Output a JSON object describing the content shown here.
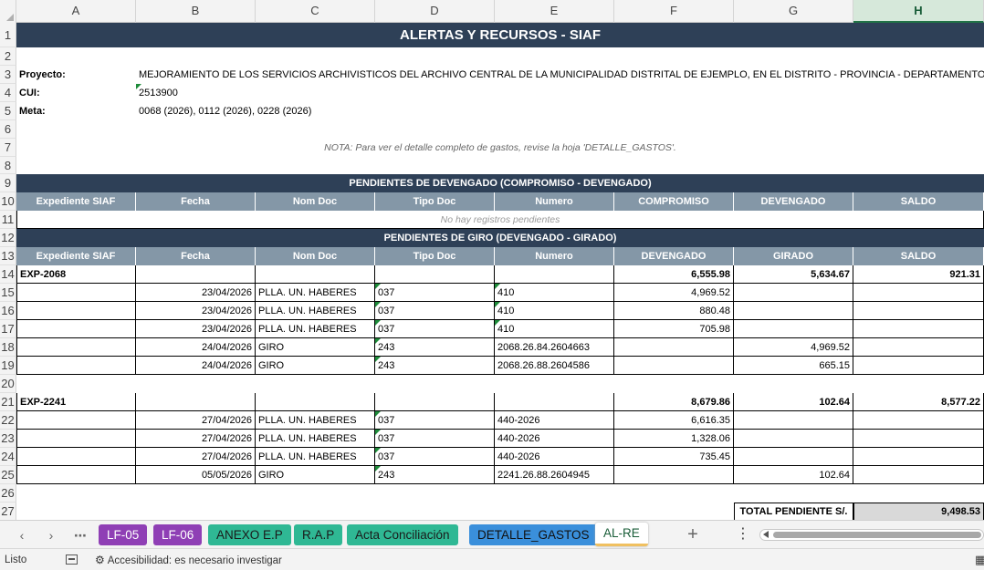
{
  "columns": [
    "A",
    "B",
    "C",
    "D",
    "E",
    "F",
    "G",
    "H"
  ],
  "selected_column": "H",
  "rows": [
    "1",
    "2",
    "3",
    "4",
    "5",
    "6",
    "7",
    "8",
    "9",
    "10",
    "11",
    "12",
    "13",
    "14",
    "15",
    "16",
    "17",
    "18",
    "19",
    "20",
    "21",
    "22",
    "23",
    "24",
    "25",
    "26",
    "27"
  ],
  "title": "ALERTAS Y RECURSOS - SIAF",
  "info": {
    "proyecto_label": "Proyecto:",
    "proyecto_value": "MEJORAMIENTO DE LOS SERVICIOS ARCHIVISTICOS DEL ARCHIVO CENTRAL DE LA MUNICIPALIDAD DISTRITAL DE EJEMPLO, EN EL DISTRITO - PROVINCIA - DEPARTAMENTO",
    "cui_label": "CUI:",
    "cui_value": "2513900",
    "meta_label": "Meta:",
    "meta_value": "0068 (2026), 0112 (2026), 0228 (2026)"
  },
  "note": "NOTA: Para ver el detalle completo de gastos, revise la hoja 'DETALLE_GASTOS'.",
  "devengado_section": {
    "banner": "PENDIENTES DE DEVENGADO (COMPROMISO - DEVENGADO)",
    "headers": [
      "Expediente SIAF",
      "Fecha",
      "Nom Doc",
      "Tipo Doc",
      "Numero",
      "COMPROMISO",
      "DEVENGADO",
      "SALDO"
    ],
    "empty_text": "No hay registros pendientes"
  },
  "giro_section": {
    "banner": "PENDIENTES DE GIRO (DEVENGADO - GIRADO)",
    "headers": [
      "Expediente SIAF",
      "Fecha",
      "Nom Doc",
      "Tipo Doc",
      "Numero",
      "DEVENGADO",
      "GIRADO",
      "SALDO"
    ]
  },
  "expedientes": [
    {
      "id": "EXP-2068",
      "devengado": "6,555.98",
      "girado": "5,634.67",
      "saldo": "921.31",
      "items": [
        {
          "fecha": "23/04/2026",
          "nom_doc": "PLLA. UN. HABERES",
          "tipo_doc": "037",
          "numero": "410",
          "devengado": "4,969.52",
          "girado": ""
        },
        {
          "fecha": "23/04/2026",
          "nom_doc": "PLLA. UN. HABERES",
          "tipo_doc": "037",
          "numero": "410",
          "devengado": "880.48",
          "girado": ""
        },
        {
          "fecha": "23/04/2026",
          "nom_doc": "PLLA. UN. HABERES",
          "tipo_doc": "037",
          "numero": "410",
          "devengado": "705.98",
          "girado": ""
        },
        {
          "fecha": "24/04/2026",
          "nom_doc": "GIRO",
          "tipo_doc": "243",
          "numero": "2068.26.84.2604663",
          "devengado": "",
          "girado": "4,969.52"
        },
        {
          "fecha": "24/04/2026",
          "nom_doc": "GIRO",
          "tipo_doc": "243",
          "numero": "2068.26.88.2604586",
          "devengado": "",
          "girado": "665.15"
        }
      ]
    },
    {
      "id": "EXP-2241",
      "devengado": "8,679.86",
      "girado": "102.64",
      "saldo": "8,577.22",
      "items": [
        {
          "fecha": "27/04/2026",
          "nom_doc": "PLLA. UN. HABERES",
          "tipo_doc": "037",
          "numero": "440-2026",
          "devengado": "6,616.35",
          "girado": ""
        },
        {
          "fecha": "27/04/2026",
          "nom_doc": "PLLA. UN. HABERES",
          "tipo_doc": "037",
          "numero": "440-2026",
          "devengado": "1,328.06",
          "girado": ""
        },
        {
          "fecha": "27/04/2026",
          "nom_doc": "PLLA. UN. HABERES",
          "tipo_doc": "037",
          "numero": "440-2026",
          "devengado": "735.45",
          "girado": ""
        },
        {
          "fecha": "05/05/2026",
          "nom_doc": "GIRO",
          "tipo_doc": "243",
          "numero": "2241.26.88.2604945",
          "devengado": "",
          "girado": "102.64"
        }
      ]
    }
  ],
  "total": {
    "label": "TOTAL PENDIENTE S/.",
    "value": "9,498.53"
  },
  "sheet_tabs": [
    {
      "label": "LF-05",
      "color": "#8f3fb5"
    },
    {
      "label": "LF-06",
      "color": "#8f3fb5"
    },
    {
      "label": "ANEXO E.P",
      "color": "#2fb894"
    },
    {
      "label": "R.A.P",
      "color": "#2fb894"
    },
    {
      "label": "Acta Conciliación",
      "color": "#2fb894"
    },
    {
      "label": "DETALLE_GASTOS",
      "color": "#3a8fdb"
    },
    {
      "label": "AL-RE",
      "color": "#ffffff"
    }
  ],
  "active_tab": "AL-RE",
  "status": {
    "ready": "Listo",
    "accessibility": "Accesibilidad: es necesario investigar"
  }
}
